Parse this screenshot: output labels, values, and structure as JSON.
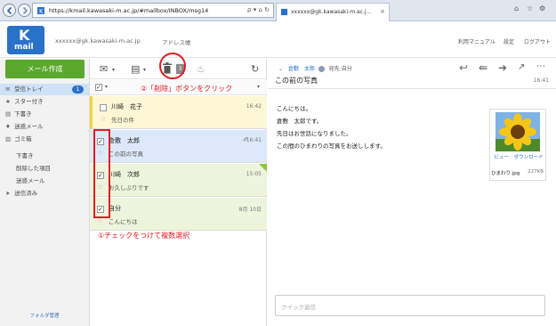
{
  "browser": {
    "url": "https://kmail.kawasaki-m.ac.jp/#mailbox/INBOX/msg14",
    "url_controls": "ρ ▾ ⌂ ↻",
    "tab_title": "xxxxxx@gk.kawasaki-m.ac.j...",
    "tab_close": "×"
  },
  "header": {
    "logo_k": "K",
    "logo_mail": "mail",
    "account": "xxxxxx@gk.kawasaki-m.ac.jp",
    "address_book": "アドレス帳",
    "links": [
      "利用マニュアル",
      "設定",
      "ログアウト"
    ]
  },
  "sidebar": {
    "compose": "メール作成",
    "items": [
      {
        "label": "受信トレイ",
        "icon": "inbox-icon",
        "glyph": "✉",
        "badge": "1"
      },
      {
        "label": "スター付き",
        "icon": "star-icon",
        "glyph": "★"
      },
      {
        "label": "下書き",
        "icon": "draft-icon",
        "glyph": "▤"
      },
      {
        "label": "迷惑メール",
        "icon": "spam-icon",
        "glyph": "♦"
      },
      {
        "label": "ゴミ箱",
        "icon": "trash-icon",
        "glyph": "▥"
      },
      {
        "label": "下書き",
        "icon": "",
        "glyph": ""
      },
      {
        "label": "削除した項目",
        "icon": "",
        "glyph": ""
      },
      {
        "label": "迷惑メール",
        "icon": "",
        "glyph": ""
      },
      {
        "label": "送信済み",
        "icon": "sent-icon",
        "glyph": "➤"
      }
    ],
    "folder_admin": "フォルダ管理"
  },
  "list": {
    "count_badge": "3",
    "annotation_delete": "②「削除」ボタンをクリック",
    "annotation_select": "①チェックをつけて複数選択",
    "messages": [
      {
        "from": "川崎　花子",
        "subject": "先日の件",
        "date": "16:42",
        "checked": false,
        "check": ""
      },
      {
        "from": "倉敷　太郎",
        "subject": "この前の写真",
        "date": "16:41",
        "checked": true,
        "check": "✓"
      },
      {
        "from": "川崎　次郎",
        "subject": "お久しぶりです",
        "date": "15:05",
        "checked": true,
        "check": "✓"
      },
      {
        "from": "自分",
        "subject": "こんにちは",
        "date": "8月 10日",
        "checked": true,
        "check": "✓"
      }
    ]
  },
  "reader": {
    "sender": "倉敷　太郎",
    "recipient": "宛先 自分",
    "subject": "この前の写真",
    "time": "16:41",
    "body": [
      "こんにちは。",
      "倉敷　太郎です。",
      "先日はお世話になりました。",
      "この間のひまわりの写真をお送しします。"
    ],
    "attachment": {
      "view": "ビュー",
      "download": "ダウンロード",
      "name": "ひまわり.jpg",
      "size": "227KB"
    },
    "quick_reply_placeholder": "クイック返信"
  },
  "colors": {
    "accent": "#2a72c8",
    "compose": "#5aa82e",
    "annotation": "#e31b23"
  }
}
